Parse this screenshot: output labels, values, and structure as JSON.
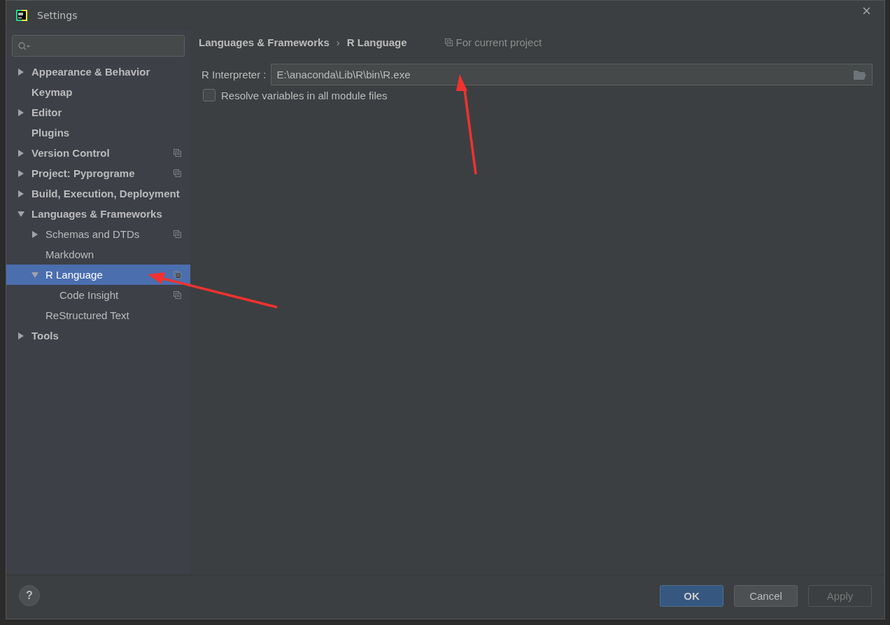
{
  "window": {
    "title": "Settings"
  },
  "tree": [
    {
      "label": "Appearance & Behavior",
      "expanded": false,
      "selected": false,
      "project_scope": false
    },
    {
      "label": "Keymap",
      "selected": false,
      "project_scope": false
    },
    {
      "label": "Editor",
      "expanded": false,
      "selected": false,
      "project_scope": false
    },
    {
      "label": "Plugins",
      "selected": false,
      "project_scope": false
    },
    {
      "label": "Version Control",
      "expanded": false,
      "selected": false,
      "project_scope": true
    },
    {
      "label": "Project: Pyprograme",
      "expanded": false,
      "selected": false,
      "project_scope": true
    },
    {
      "label": "Build, Execution, Deployment",
      "expanded": false,
      "selected": false,
      "project_scope": false
    },
    {
      "label": "Languages & Frameworks",
      "expanded": true,
      "selected": false,
      "project_scope": false,
      "children": [
        {
          "label": "Schemas and DTDs",
          "expanded": false,
          "selected": false,
          "project_scope": true
        },
        {
          "label": "Markdown",
          "selected": false,
          "project_scope": false
        },
        {
          "label": "R Language",
          "expanded": true,
          "selected": true,
          "project_scope": true,
          "children": [
            {
              "label": "Code Insight",
              "selected": false,
              "project_scope": true
            }
          ]
        },
        {
          "label": "ReStructured Text",
          "selected": false,
          "project_scope": false
        }
      ]
    },
    {
      "label": "Tools",
      "expanded": false,
      "selected": false,
      "project_scope": false
    }
  ],
  "breadcrumb": [
    "Languages & Frameworks",
    "›",
    "R Language"
  ],
  "scope_note": "For current project",
  "interpreter": {
    "label": "R Interpreter :",
    "value": "E:\\anaconda\\Lib\\R\\bin\\R.exe"
  },
  "resolve_option": {
    "label": "Resolve variables in all module files",
    "checked": false
  },
  "buttons": [
    {
      "label": "OK",
      "kind": "primary",
      "disabled": false
    },
    {
      "label": "Cancel",
      "kind": "normal",
      "disabled": false
    },
    {
      "label": "Apply",
      "kind": "normal",
      "disabled": true
    }
  ],
  "help": {
    "label": "?"
  }
}
